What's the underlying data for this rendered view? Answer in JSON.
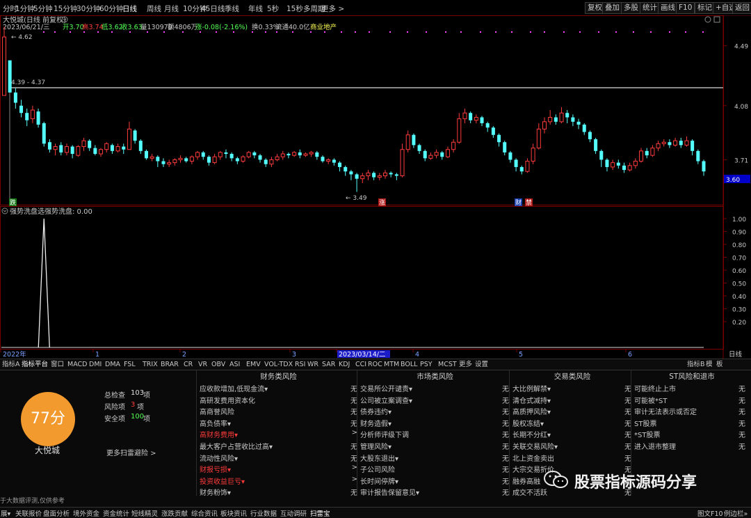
{
  "top_bar": {
    "periods": [
      "分时",
      "1分钟",
      "5分钟",
      "15分钟",
      "30分钟",
      "60分钟",
      "日线",
      "周线",
      "月线",
      "10分钟",
      "45日线",
      "季线",
      "年线",
      "5秒",
      "15秒",
      "多周期",
      "更多 >"
    ],
    "active_period": "日线",
    "right_buttons": [
      "复权",
      "叠加",
      "多股",
      "统计",
      "画线",
      "F10",
      "标记",
      "+自选",
      "返回"
    ]
  },
  "quote": {
    "title": "大悦城(日线 前复权)",
    "line": [
      "2023/06/21/三",
      "开3.70",
      "高3.74",
      "低3.62",
      "收3.63",
      "量130979",
      "额4806万",
      "涨-0.08(-2.16%)",
      "换0.33%",
      "流通40.0亿",
      "商业地产"
    ]
  },
  "price_axis": {
    "labels": [
      "4.49",
      "4.08",
      "3.71"
    ],
    "current": "3.60"
  },
  "annotations": {
    "high": "4.62",
    "range": "4.39 - 4.37",
    "low": "3.49",
    "tag_die": "跌",
    "tag_zhang": "涨",
    "tag_cai": "财",
    "tag_ban": "禁"
  },
  "indicator": {
    "title": "强势洗盘选",
    "value_label": "强势洗盘: 0.00",
    "axis_labels": [
      "1.00",
      "0.90",
      "0.80",
      "0.70",
      "0.60",
      "0.50",
      "0.40",
      "0.30",
      "0.20"
    ],
    "spikes": [
      {
        "bar": 7,
        "value": 1.0
      },
      {
        "bar": 138,
        "value": 1.0
      }
    ]
  },
  "time_axis": {
    "labels": [
      "2022年",
      "1",
      "2",
      "3",
      "2023/03/14/二",
      "4",
      "5",
      "6"
    ],
    "right_label": "日线"
  },
  "indicator_tabs": [
    "指标A",
    "指标平台",
    "窗口",
    "MACD",
    "DMI",
    "DMA",
    "FSL",
    "TRIX",
    "BRAR",
    "CR",
    "VR",
    "OBV",
    "ASI",
    "EMV",
    "VOL-TDX",
    "RSI",
    "WR",
    "SAR",
    "KDJ",
    "CCI",
    "ROC",
    "MTM",
    "BOLL",
    "PSY",
    "MCST",
    "更多",
    "设置"
  ],
  "indicator_tabs_right": [
    "指标B",
    "模",
    "板"
  ],
  "risk": {
    "score": "77分",
    "name": "大悦城",
    "summary": [
      {
        "label": "总检查",
        "value": "103",
        "unit": "项"
      },
      {
        "label": "风险项",
        "value": "3",
        "unit": "项"
      },
      {
        "label": "安全项",
        "value": "100",
        "unit": "项"
      }
    ],
    "more": "更多扫雷避险 >",
    "footer_note": "于大数据评测,仅供参考",
    "columns": [
      {
        "title": "财务类风险",
        "rows": [
          {
            "label": "应收款增加,低现金流▾",
            "value": "无",
            "red": false
          },
          {
            "label": "高研发费用资本化",
            "value": "无",
            "red": false
          },
          {
            "label": "高商誉风险",
            "value": "无",
            "red": false
          },
          {
            "label": "高负债率▾",
            "value": "无",
            "red": false
          },
          {
            "label": "高财务费用▾",
            "value": ">",
            "red": true
          },
          {
            "label": "最大客户占营收比过高▾",
            "value": "无",
            "red": false
          },
          {
            "label": "流动性风险▾",
            "value": "无",
            "red": false
          },
          {
            "label": "财报亏损▾",
            "value": ">",
            "red": true
          },
          {
            "label": "投资收益巨亏▾",
            "value": ">",
            "red": true
          },
          {
            "label": "财务粉饰▾",
            "value": "无",
            "red": false
          }
        ]
      },
      {
        "title": "市场类风险",
        "rows": [
          {
            "label": "交易所公开谴责▾",
            "value": "无",
            "red": false
          },
          {
            "label": "公司被立案调查▾",
            "value": "无",
            "red": false
          },
          {
            "label": "债券违约▾",
            "value": "无",
            "red": false
          },
          {
            "label": "财务造假▾",
            "value": "无",
            "red": false
          },
          {
            "label": "分析师评级下调",
            "value": "无",
            "red": false
          },
          {
            "label": "管理风险▾",
            "value": "无",
            "red": false
          },
          {
            "label": "大股东退出▾",
            "value": "无",
            "red": false
          },
          {
            "label": "子公司风险",
            "value": "无",
            "red": false
          },
          {
            "label": "长时间停牌▾",
            "value": "无",
            "red": false
          },
          {
            "label": "审计报告保留意见▾",
            "value": "无",
            "red": false
          }
        ]
      },
      {
        "title": "交易类风险",
        "rows": [
          {
            "label": "大比例解禁▾",
            "value": "无",
            "red": false
          },
          {
            "label": "清仓式减持▾",
            "value": "无",
            "red": false
          },
          {
            "label": "高质押风险▾",
            "value": "无",
            "red": false
          },
          {
            "label": "股权冻结▾",
            "value": "无",
            "red": false
          },
          {
            "label": "长期不分红▾",
            "value": "无",
            "red": false
          },
          {
            "label": "关联交易风险▾",
            "value": "无",
            "red": false
          },
          {
            "label": "北上资金卖出",
            "value": "无",
            "red": false
          },
          {
            "label": "大宗交易折价",
            "value": "无",
            "red": false
          },
          {
            "label": "融券高融",
            "value": "无",
            "red": false
          },
          {
            "label": "成交不活跃",
            "value": "无",
            "red": false
          }
        ]
      },
      {
        "title": "ST风险和退市",
        "rows": [
          {
            "label": "可能终止上市",
            "value": "无",
            "red": false
          },
          {
            "label": "可能被*ST",
            "value": "无",
            "red": false
          },
          {
            "label": "审计无法表示或否定",
            "value": "无",
            "red": false
          },
          {
            "label": "ST股票",
            "value": "无",
            "red": false
          },
          {
            "label": "*ST股票",
            "value": "无",
            "red": false
          },
          {
            "label": "进入退市整理",
            "value": "无",
            "red": false
          }
        ]
      }
    ]
  },
  "bottom_tabs": [
    "展▾",
    "关联报价",
    "盘面分析",
    "境外资金",
    "资金统计",
    "短线精灵",
    "涨跌贡献",
    "综合资讯",
    "板块资讯",
    "行业数据",
    "互动调研",
    "扫雷宝"
  ],
  "bottom_active": "扫雷宝",
  "bottom_right": [
    "图文F10",
    "例边栏»"
  ],
  "watermark": "股票指标源码分享",
  "colors": {
    "up": "#ff3c3c",
    "down": "#54ffff",
    "bg": "#000000",
    "grid": "#7a0000",
    "magenta": "#ff44ff",
    "score_bg": "#f29a2e"
  },
  "chart_data": {
    "type": "candlestick",
    "title": "大悦城(日线 前复权)",
    "y_ticks": [
      4.49,
      4.08,
      3.71
    ],
    "ylim": [
      3.45,
      4.66
    ],
    "candles": [
      [
        4.15,
        4.55,
        4.15,
        4.62
      ],
      [
        4.39,
        4.17,
        4.17,
        4.39
      ],
      [
        4.17,
        4.1,
        4.06,
        4.2
      ],
      [
        4.08,
        4.03,
        4.0,
        4.12
      ],
      [
        4.03,
        3.98,
        3.94,
        4.06
      ],
      [
        3.99,
        4.05,
        3.96,
        4.08
      ],
      [
        4.04,
        3.95,
        3.93,
        4.06
      ],
      [
        3.96,
        3.82,
        3.8,
        3.97
      ],
      [
        3.83,
        3.78,
        3.76,
        3.85
      ],
      [
        3.78,
        3.8,
        3.74,
        3.82
      ],
      [
        3.81,
        3.76,
        3.74,
        3.83
      ],
      [
        3.76,
        3.8,
        3.74,
        3.82
      ],
      [
        3.8,
        3.75,
        3.72,
        3.81
      ],
      [
        3.74,
        3.8,
        3.73,
        3.81
      ],
      [
        3.8,
        3.84,
        3.77,
        3.86
      ],
      [
        3.84,
        3.79,
        3.77,
        3.85
      ],
      [
        3.79,
        3.75,
        3.74,
        3.81
      ],
      [
        3.75,
        3.78,
        3.73,
        3.79
      ],
      [
        3.78,
        3.82,
        3.76,
        3.83
      ],
      [
        3.81,
        3.77,
        3.75,
        3.82
      ],
      [
        3.77,
        3.8,
        3.76,
        3.82
      ],
      [
        3.8,
        3.78,
        3.75,
        3.82
      ],
      [
        3.78,
        3.92,
        3.78,
        3.97
      ],
      [
        3.91,
        3.84,
        3.82,
        3.92
      ],
      [
        3.84,
        3.77,
        3.75,
        3.85
      ],
      [
        3.77,
        3.72,
        3.71,
        3.78
      ],
      [
        3.72,
        3.73,
        3.7,
        3.75
      ],
      [
        3.73,
        3.7,
        3.66,
        3.74
      ],
      [
        3.7,
        3.68,
        3.66,
        3.72
      ],
      [
        3.68,
        3.69,
        3.66,
        3.71
      ],
      [
        3.69,
        3.71,
        3.67,
        3.72
      ],
      [
        3.71,
        3.72,
        3.69,
        3.74
      ],
      [
        3.72,
        3.7,
        3.69,
        3.73
      ],
      [
        3.7,
        3.73,
        3.68,
        3.74
      ],
      [
        3.73,
        3.76,
        3.71,
        3.77
      ],
      [
        3.76,
        3.73,
        3.71,
        3.77
      ],
      [
        3.73,
        3.69,
        3.67,
        3.74
      ],
      [
        3.69,
        3.73,
        3.68,
        3.75
      ],
      [
        3.73,
        3.76,
        3.71,
        3.77
      ],
      [
        3.76,
        3.75,
        3.72,
        3.78
      ],
      [
        3.75,
        3.72,
        3.7,
        3.76
      ],
      [
        3.72,
        3.7,
        3.68,
        3.73
      ],
      [
        3.7,
        3.73,
        3.69,
        3.74
      ],
      [
        3.73,
        3.76,
        3.72,
        3.77
      ],
      [
        3.76,
        3.74,
        3.72,
        3.77
      ],
      [
        3.74,
        3.71,
        3.69,
        3.75
      ],
      [
        3.71,
        3.68,
        3.66,
        3.72
      ],
      [
        3.68,
        3.71,
        3.66,
        3.73
      ],
      [
        3.71,
        3.73,
        3.7,
        3.75
      ],
      [
        3.73,
        3.75,
        3.71,
        3.77
      ],
      [
        3.75,
        3.74,
        3.72,
        3.76
      ],
      [
        3.74,
        3.76,
        3.73,
        3.77
      ],
      [
        3.76,
        3.74,
        3.72,
        3.78
      ],
      [
        3.74,
        3.75,
        3.73,
        3.76
      ],
      [
        3.75,
        3.76,
        3.73,
        3.77
      ],
      [
        3.76,
        3.73,
        3.71,
        3.77
      ],
      [
        3.73,
        3.7,
        3.69,
        3.74
      ],
      [
        3.7,
        3.71,
        3.68,
        3.72
      ],
      [
        3.71,
        3.69,
        3.67,
        3.72
      ],
      [
        3.69,
        3.66,
        3.63,
        3.7
      ],
      [
        3.66,
        3.63,
        3.6,
        3.67
      ],
      [
        3.63,
        3.61,
        3.57,
        3.64
      ],
      [
        3.61,
        3.58,
        3.49,
        3.62
      ],
      [
        3.58,
        3.6,
        3.55,
        3.62
      ],
      [
        3.6,
        3.62,
        3.57,
        3.64
      ],
      [
        3.62,
        3.59,
        3.57,
        3.63
      ],
      [
        3.59,
        3.6,
        3.57,
        3.62
      ],
      [
        3.6,
        3.62,
        3.58,
        3.64
      ],
      [
        3.62,
        3.61,
        3.59,
        3.63
      ],
      [
        3.61,
        3.6,
        3.57,
        3.62
      ],
      [
        3.6,
        3.78,
        3.59,
        3.82
      ],
      [
        3.78,
        3.88,
        3.76,
        3.91
      ],
      [
        3.88,
        3.81,
        3.79,
        3.89
      ],
      [
        3.81,
        3.77,
        3.75,
        3.82
      ],
      [
        3.77,
        3.72,
        3.7,
        3.78
      ],
      [
        3.72,
        3.74,
        3.71,
        3.76
      ],
      [
        3.74,
        3.76,
        3.72,
        3.78
      ],
      [
        3.76,
        3.73,
        3.71,
        3.77
      ],
      [
        3.73,
        3.78,
        3.72,
        3.8
      ],
      [
        3.78,
        3.83,
        3.76,
        3.85
      ],
      [
        3.83,
        3.99,
        3.82,
        4.03
      ],
      [
        3.99,
        4.03,
        3.96,
        4.06
      ],
      [
        4.03,
        3.98,
        3.96,
        4.04
      ],
      [
        3.98,
        4.0,
        3.96,
        4.02
      ],
      [
        4.0,
        3.96,
        3.94,
        4.01
      ],
      [
        3.96,
        3.93,
        3.9,
        3.97
      ],
      [
        3.93,
        3.88,
        3.86,
        3.94
      ],
      [
        3.88,
        3.83,
        3.8,
        3.89
      ],
      [
        3.83,
        3.76,
        3.74,
        3.84
      ],
      [
        3.76,
        3.71,
        3.69,
        3.77
      ],
      [
        3.71,
        3.66,
        3.63,
        3.72
      ],
      [
        3.66,
        3.63,
        3.61,
        3.67
      ],
      [
        3.63,
        3.7,
        3.62,
        3.72
      ],
      [
        3.7,
        3.79,
        3.68,
        3.82
      ],
      [
        3.79,
        3.92,
        3.78,
        3.96
      ],
      [
        3.92,
        3.97,
        3.89,
        4.0
      ],
      [
        3.97,
        4.0,
        3.95,
        4.05
      ],
      [
        4.0,
        3.97,
        3.95,
        4.02
      ],
      [
        3.97,
        4.03,
        3.96,
        4.07
      ],
      [
        4.03,
        4.0,
        3.96,
        4.05
      ],
      [
        4.0,
        3.97,
        3.94,
        4.02
      ],
      [
        3.97,
        3.95,
        3.92,
        3.99
      ],
      [
        3.95,
        3.9,
        3.88,
        3.96
      ],
      [
        3.9,
        3.85,
        3.83,
        3.91
      ],
      [
        3.85,
        3.77,
        3.75,
        3.86
      ],
      [
        3.77,
        3.71,
        3.66,
        3.78
      ],
      [
        3.71,
        3.66,
        3.63,
        3.72
      ],
      [
        3.66,
        3.69,
        3.64,
        3.71
      ],
      [
        3.69,
        3.67,
        3.65,
        3.71
      ],
      [
        3.67,
        3.64,
        3.62,
        3.69
      ],
      [
        3.64,
        3.67,
        3.63,
        3.69
      ],
      [
        3.67,
        3.7,
        3.65,
        3.72
      ],
      [
        3.7,
        3.77,
        3.69,
        3.79
      ],
      [
        3.77,
        3.74,
        3.72,
        3.79
      ],
      [
        3.74,
        3.79,
        3.73,
        3.81
      ],
      [
        3.79,
        3.82,
        3.77,
        3.84
      ],
      [
        3.82,
        3.83,
        3.8,
        3.85
      ],
      [
        3.83,
        3.81,
        3.79,
        3.85
      ],
      [
        3.81,
        3.84,
        3.8,
        3.86
      ],
      [
        3.84,
        3.81,
        3.79,
        3.86
      ],
      [
        3.81,
        3.84,
        3.8,
        3.87
      ],
      [
        3.84,
        3.77,
        3.74,
        3.85
      ],
      [
        3.77,
        3.7,
        3.68,
        3.78
      ],
      [
        3.7,
        3.63,
        3.6,
        3.71
      ]
    ]
  }
}
